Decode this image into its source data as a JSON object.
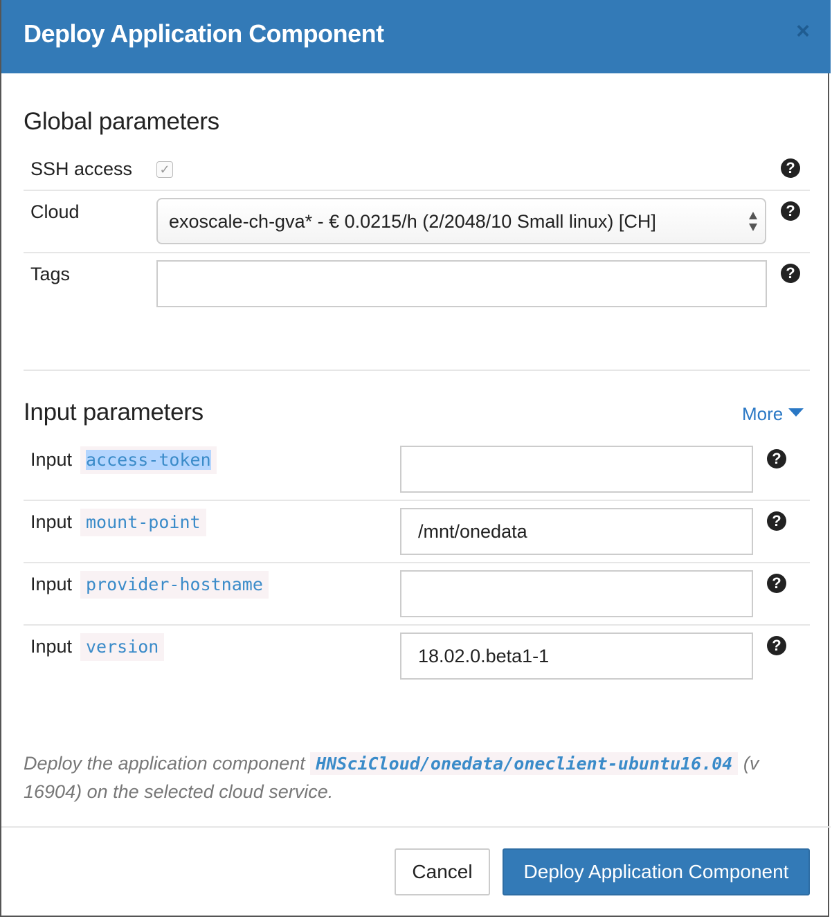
{
  "header": {
    "title": "Deploy Application Component",
    "close_symbol": "×"
  },
  "global": {
    "title": "Global parameters",
    "ssh_label": "SSH access",
    "ssh_checked": true,
    "cloud_label": "Cloud",
    "cloud_value": "exoscale-ch-gva* - € 0.0215/h (2/2048/10 Small linux) [CH]",
    "tags_label": "Tags",
    "tags_value": ""
  },
  "inputs": {
    "title": "Input parameters",
    "more_label": "More",
    "rows": [
      {
        "prefix": "Input",
        "name": "access-token",
        "value": ""
      },
      {
        "prefix": "Input",
        "name": "mount-point",
        "value": "/mnt/onedata"
      },
      {
        "prefix": "Input",
        "name": "provider-hostname",
        "value": ""
      },
      {
        "prefix": "Input",
        "name": "version",
        "value": "18.02.0.beta1-1"
      }
    ]
  },
  "footer": {
    "text_before": "Deploy the application component",
    "component_path": "HNSciCloud/onedata/oneclient-ubuntu16.04",
    "text_after": "(v 16904) on the selected cloud service.",
    "cancel_label": "Cancel",
    "deploy_label": "Deploy Application Component"
  },
  "colors": {
    "header_bg": "#337ab7",
    "primary_button": "#337ab7",
    "code_text": "#3a8bc9"
  },
  "icons": {
    "help": "question-circle-icon",
    "close": "close-icon",
    "checkbox": "checkmark-icon",
    "select": "select-arrows-icon",
    "more": "caret-down-icon"
  }
}
